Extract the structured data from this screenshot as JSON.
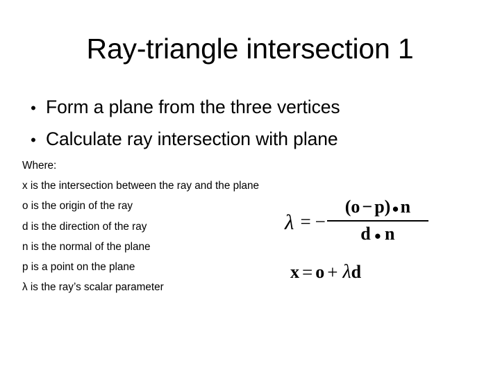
{
  "slide": {
    "title": "Ray-triangle intersection 1",
    "background_color": "#ffffff",
    "text_color": "#000000"
  },
  "bullets": {
    "marker": "•",
    "items": [
      {
        "text": "Form a plane from the three vertices"
      },
      {
        "text": "Calculate ray intersection with plane"
      }
    ]
  },
  "definitions": {
    "heading": "Where:",
    "lines": [
      "x is the intersection between the ray and the plane",
      "o is the origin of the ray",
      "d is the direction of the ray",
      "n is the normal of the plane",
      "p is a point on the plane",
      "λ is the ray’s scalar parameter"
    ]
  },
  "equations": {
    "lambda_equation": {
      "lhs": "λ",
      "equals": "=",
      "sign": "−",
      "numerator_open": "(",
      "numerator_o": "o",
      "numerator_minus": "−",
      "numerator_p": "p",
      "numerator_close": ")",
      "numerator_dot": "●",
      "numerator_n": "n",
      "denominator_d": "d",
      "denominator_dot": "●",
      "denominator_n": "n"
    },
    "point_equation": {
      "lhs": "x",
      "equals": "=",
      "origin": "o",
      "plus": "+",
      "lambda": "λ",
      "direction": "d"
    }
  }
}
